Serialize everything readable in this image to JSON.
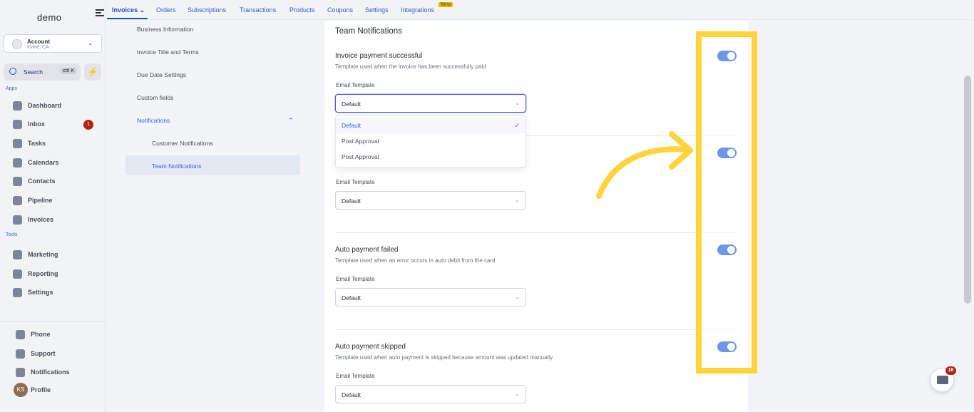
{
  "app": {
    "logo": "demo"
  },
  "account": {
    "name": "Account",
    "location": "Irvine, CA"
  },
  "search": {
    "label": "Search",
    "shortcut": "ctrl K"
  },
  "sidebar": {
    "apps_label": "Apps",
    "tools_label": "Tools",
    "apps": [
      "Dashboard",
      "Inbox",
      "Tasks",
      "Calendars",
      "Contacts",
      "Pipeline",
      "Invoices"
    ],
    "inbox_badge": "1",
    "tools": [
      "Marketing",
      "Reporting",
      "Settings"
    ],
    "bottom": [
      "Phone",
      "Support",
      "Notifications",
      "Profile"
    ],
    "avatar_initials": "KS"
  },
  "topnav": {
    "tabs": [
      "Invoices",
      "Orders",
      "Subscriptions",
      "Transactions",
      "Products",
      "Coupons",
      "Settings",
      "Integrations"
    ],
    "new_badge": "New"
  },
  "subnav": {
    "items": [
      "Business Information",
      "Invoice Title and Terms",
      "Due Date Settings",
      "Custom fields",
      "Notifications"
    ],
    "children": [
      "Customer Notifications",
      "Team Notifications"
    ]
  },
  "main": {
    "title": "Team Notifications",
    "items": [
      {
        "title": "Invoice payment successful",
        "desc": "Template used when the invoice has been successfully paid",
        "field_label": "Email Template",
        "value": "Default",
        "enabled": true
      },
      {
        "title": "",
        "desc": "",
        "field_label": "Email Template",
        "value": "Default",
        "enabled": true
      },
      {
        "title": "Auto payment failed",
        "desc": "Template used when an error occurs in auto debit from the card",
        "field_label": "Email Template",
        "value": "Default",
        "enabled": true
      },
      {
        "title": "Auto payment skipped",
        "desc": "Template used when auto payment is skipped because amount was updated manually",
        "field_label": "Email Template",
        "value": "Default",
        "enabled": true
      }
    ],
    "dropdown_options": [
      "Default",
      "Post Approval",
      "Post Approval"
    ],
    "selected_option_check": "✓"
  },
  "chat": {
    "badge": "16"
  },
  "colors": {
    "accent": "#1f5fe0",
    "highlight": "#ffd43b"
  }
}
